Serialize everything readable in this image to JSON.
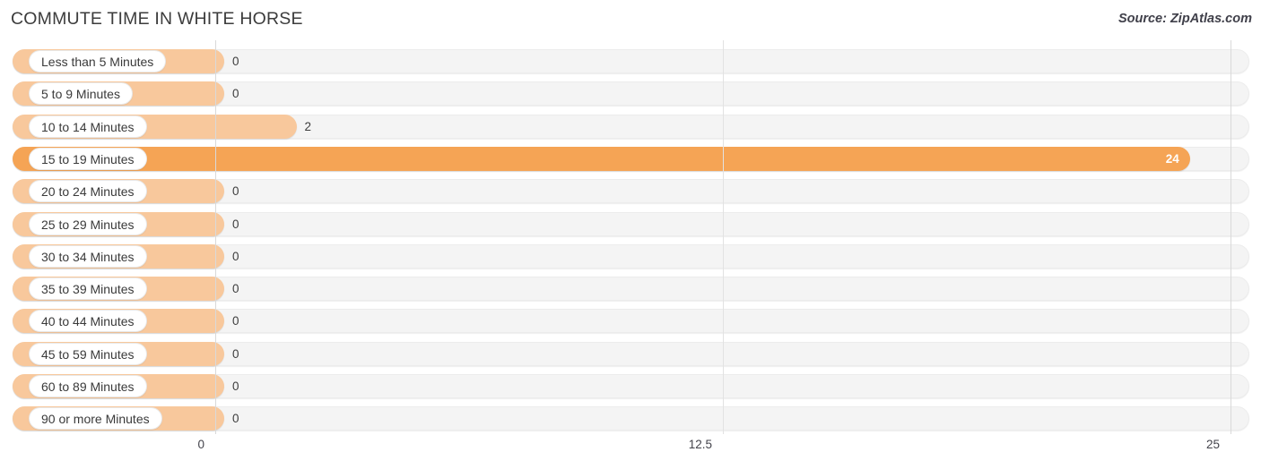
{
  "header": {
    "title": "COMMUTE TIME IN WHITE HORSE",
    "source": "Source: ZipAtlas.com"
  },
  "colors": {
    "bar": "#f8c89c",
    "bar_highlight": "#f5a455",
    "track": "#f4f4f4",
    "text": "#3a3a3a",
    "gridline": "#d9d9d9"
  },
  "chart_data": {
    "type": "bar",
    "orientation": "horizontal",
    "title": "COMMUTE TIME IN WHITE HORSE",
    "xlabel": "",
    "ylabel": "",
    "xlim": [
      0,
      25
    ],
    "grid": true,
    "legend": false,
    "xticks": [
      {
        "label": "0",
        "value": 0
      },
      {
        "label": "12.5",
        "value": 12.5
      },
      {
        "label": "25",
        "value": 25
      }
    ],
    "categories": [
      "Less than 5 Minutes",
      "5 to 9 Minutes",
      "10 to 14 Minutes",
      "15 to 19 Minutes",
      "20 to 24 Minutes",
      "25 to 29 Minutes",
      "30 to 34 Minutes",
      "35 to 39 Minutes",
      "40 to 44 Minutes",
      "45 to 59 Minutes",
      "60 to 89 Minutes",
      "90 or more Minutes"
    ],
    "values": [
      0,
      0,
      2,
      24,
      0,
      0,
      0,
      0,
      0,
      0,
      0,
      0
    ],
    "value_labels": [
      "0",
      "0",
      "2",
      "24",
      "0",
      "0",
      "0",
      "0",
      "0",
      "0",
      "0",
      "0"
    ],
    "highlight_index": 3
  }
}
